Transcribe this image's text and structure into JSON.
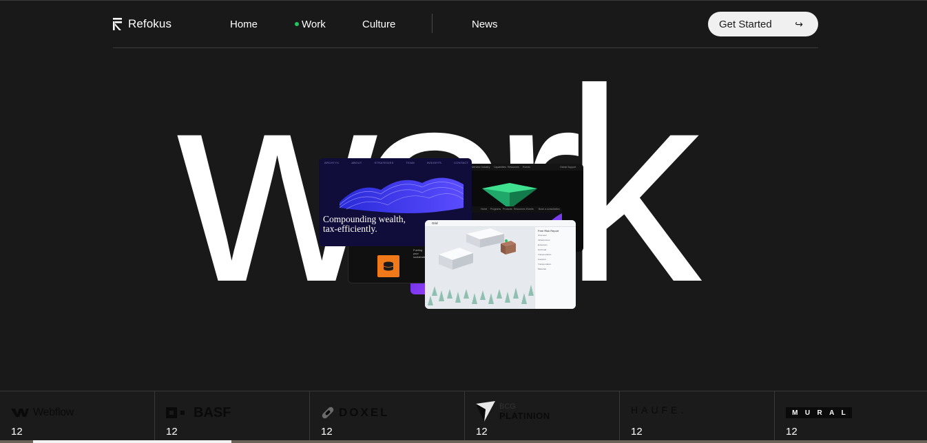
{
  "brand": {
    "name": "Refokus"
  },
  "nav": {
    "links": [
      {
        "label": "Home",
        "active": false
      },
      {
        "label": "Work",
        "active": true
      },
      {
        "label": "Culture",
        "active": false
      },
      {
        "label": "News",
        "active": false
      }
    ],
    "cta_label": "Get Started",
    "cta_arrow": "↪",
    "active_dot_color": "#22c55e"
  },
  "hero": {
    "word": "work",
    "cards": {
      "finance": {
        "headline_line1": "Compounding wealth,",
        "headline_line2": "tax-efficiently.",
        "brand": "ARCHTYX",
        "menu": [
          "ABOUT",
          "STRATEGIES",
          "TEAM",
          "INSIGHTS",
          "CONTACT"
        ]
      },
      "dark_product": {
        "menu": [
          "Overview",
          "Industry",
          "Capabilities",
          "Resources",
          "Events"
        ],
        "right_label": "Global Support"
      },
      "orange_panel": {
        "tag": "Fueling your sustainability"
      },
      "dashboard": {
        "menu": [
          "Home",
          "Programs",
          "Products",
          "Resources",
          "Events"
        ],
        "right_label": "Book a consultation"
      },
      "map_app": {
        "brand": "Grid",
        "side_title": "Free Risk Report",
        "side_items": [
          "Overview",
          "Infrastructure",
          "Emissions",
          "Grid load",
          "Transportation",
          "Footprint",
          "Transportation",
          "Materials"
        ]
      }
    }
  },
  "clients": [
    {
      "name": "Webflow",
      "count": "12",
      "icon": "webflow-icon"
    },
    {
      "name": "BASF",
      "count": "12",
      "icon": "basf-icon"
    },
    {
      "name": "DOXEL",
      "count": "12",
      "icon": "doxel-icon"
    },
    {
      "name_line1": "BCG",
      "name_line2": "PLATINION",
      "count": "12",
      "icon": "bcg-platinion-icon"
    },
    {
      "name": "HAUFE.",
      "count": "12",
      "icon": "haufe-icon"
    },
    {
      "letters": [
        "M",
        "U",
        "R",
        "A",
        "L"
      ],
      "count": "12",
      "icon": "mural-icon"
    }
  ],
  "carousel_progress": 0.214
}
